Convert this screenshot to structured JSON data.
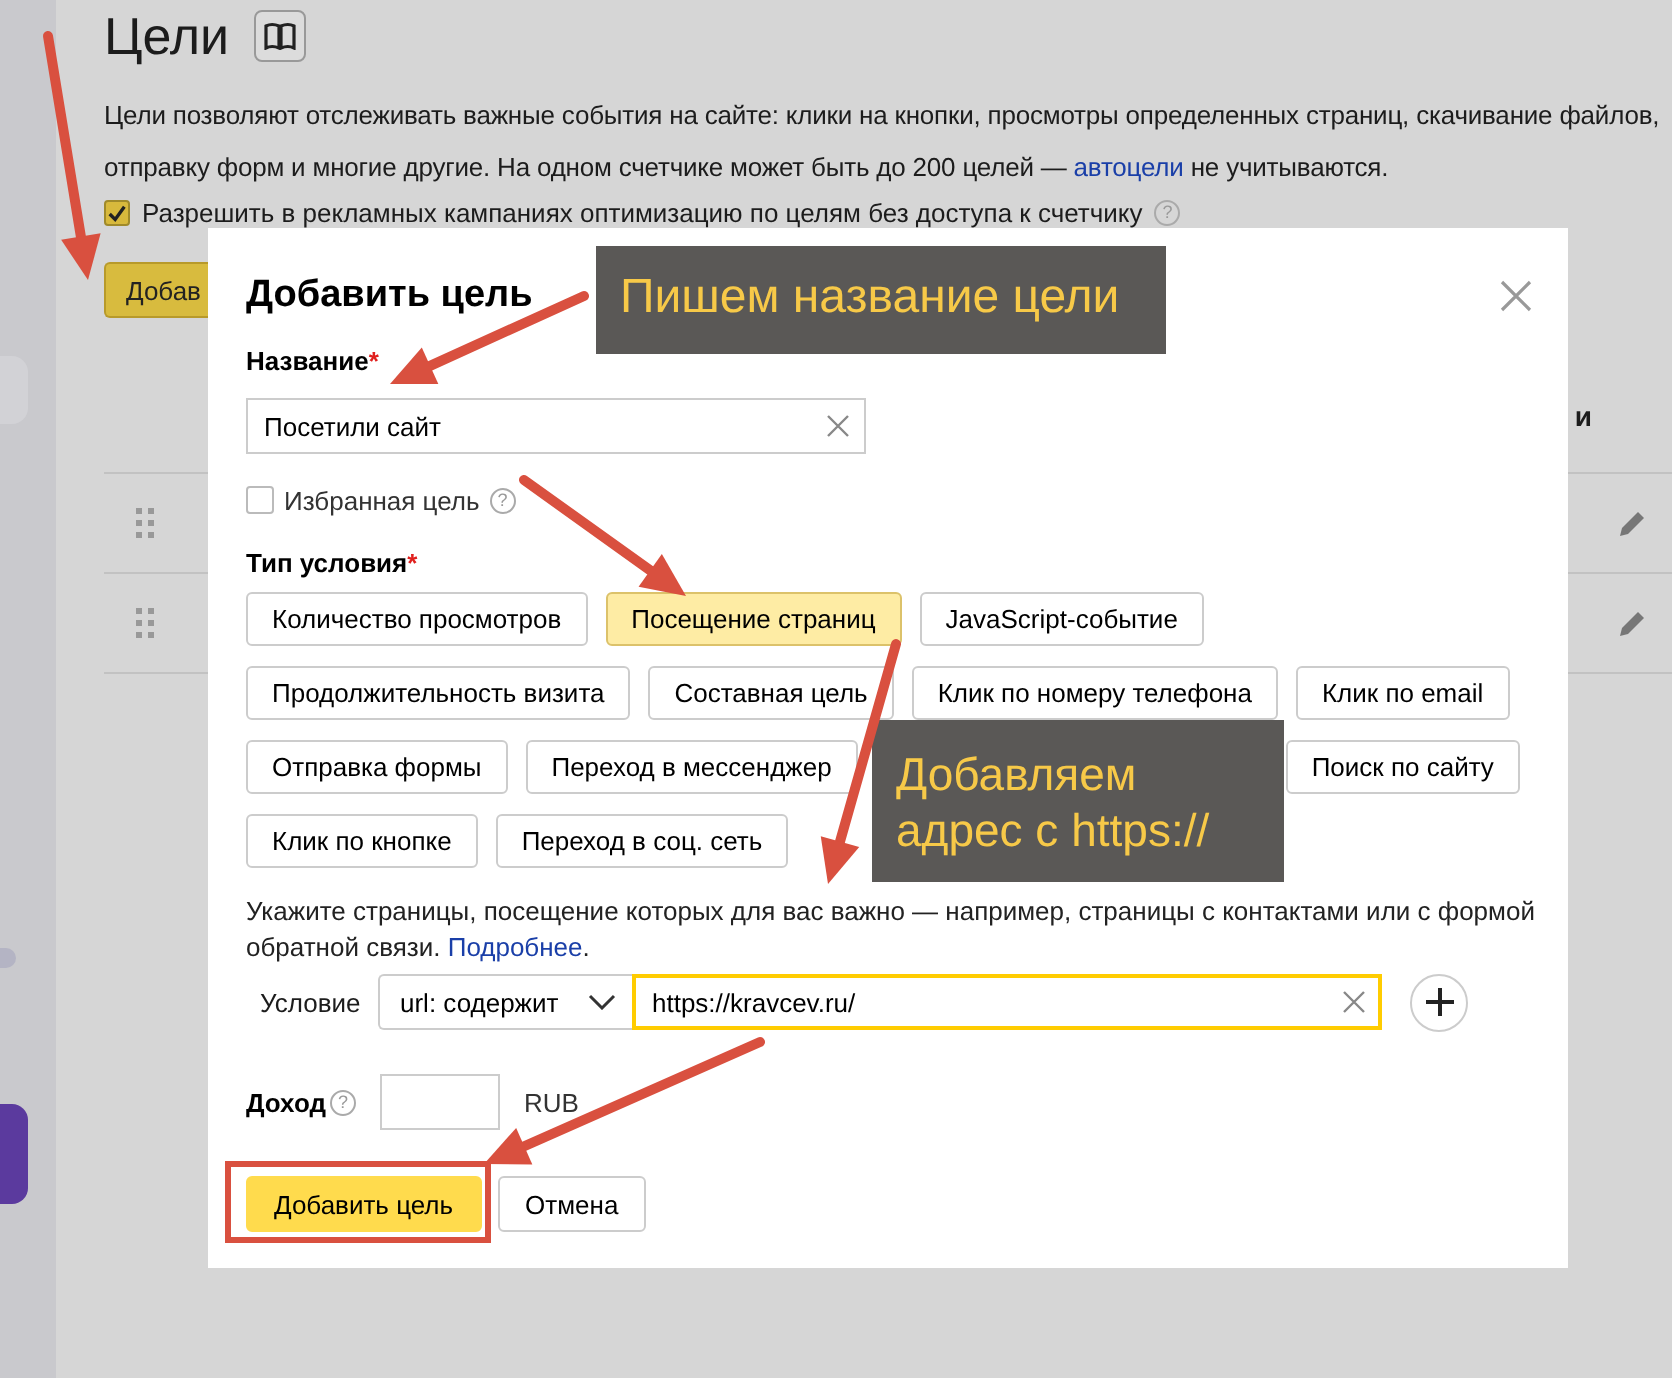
{
  "page": {
    "title": "Цели",
    "description": {
      "before": "Цели позволяют отслеживать важные события на сайте: клики на кнопки, просмотры определенных страниц, скачивание файлов, отправку форм и многие другие. На одном счетчике может быть до 200 целей — ",
      "link": "автоцели",
      "after": " не учитываются."
    },
    "allow_optimization": {
      "label": "Разрешить в рекламных кампаниях оптимизацию по целям без доступа к счетчику",
      "checked": true,
      "help": "?"
    },
    "add_button": "Добав",
    "table": {
      "column_header": "и"
    }
  },
  "dialog": {
    "title": "Добавить цель",
    "name_label": "Название",
    "name_required": "*",
    "name_value": "Посетили сайт",
    "favorite": {
      "label": "Избранная цель",
      "checked": false,
      "help": "?"
    },
    "type_label": "Тип условия",
    "type_required": "*",
    "condition_types": [
      [
        {
          "label": "Количество просмотров",
          "selected": false
        },
        {
          "label": "Посещение страниц",
          "selected": true
        },
        {
          "label": "JavaScript-событие",
          "selected": false
        }
      ],
      [
        {
          "label": "Продолжительность визита",
          "selected": false
        },
        {
          "label": "Составная цель",
          "selected": false
        },
        {
          "label": "Клик по номеру телефона",
          "selected": false
        },
        {
          "label": "Клик по email",
          "selected": false
        }
      ],
      [
        {
          "label": "Отправка формы",
          "selected": false
        },
        {
          "label": "Переход в мессенджер",
          "selected": false
        },
        {
          "label": "Поиск по сайту",
          "selected": false
        }
      ],
      [
        {
          "label": "Клик по кнопке",
          "selected": false
        },
        {
          "label": "Переход в соц. сеть",
          "selected": false
        }
      ]
    ],
    "hint": {
      "before": "Укажите страницы, посещение которых для вас важно — например, страницы с контактами или с формой обратной связи. ",
      "link": "Подробнее",
      "after": "."
    },
    "condition_label": "Условие",
    "condition_select": "url: содержит",
    "condition_value": "https://kravcev.ru/",
    "income_label": "Доход",
    "income_help": "?",
    "currency": "RUB",
    "buttons": [
      {
        "label": "Добавить цель",
        "kind": "primary"
      },
      {
        "label": "Отмена",
        "kind": "secondary"
      }
    ]
  },
  "annotations": {
    "callouts": [
      {
        "text": "Пишем название цели"
      },
      {
        "text": "Добавляем адрес с https://"
      }
    ]
  }
}
